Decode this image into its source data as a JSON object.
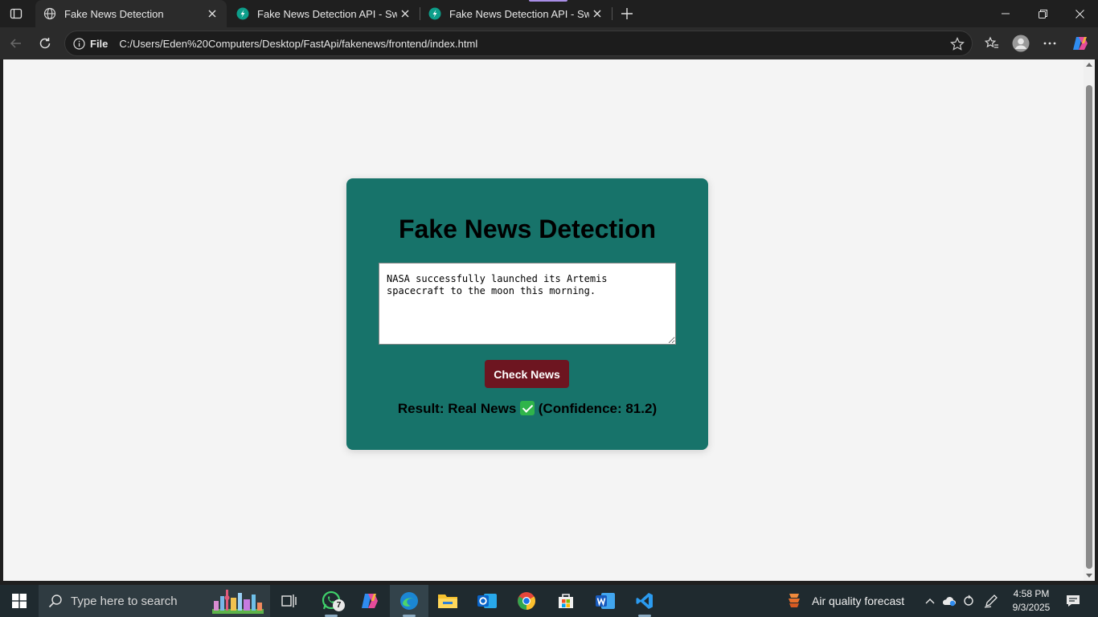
{
  "browser": {
    "tabs": [
      {
        "title": "Fake News Detection",
        "icon": "globe-icon",
        "active": true
      },
      {
        "title": "Fake News Detection API - Swagger UI",
        "icon": "swagger-icon",
        "active": false
      },
      {
        "title": "Fake News Detection API - Swagger UI",
        "icon": "swagger-icon",
        "active": false
      }
    ],
    "address": {
      "scheme_label": "File",
      "url": "C:/Users/Eden%20Computers/Desktop/FastApi/fakenews/frontend/index.html"
    }
  },
  "page": {
    "title": "Fake News Detection",
    "news_text": "NASA successfully launched its Artemis spacecraft to the moon this morning.",
    "button_label": "Check News",
    "result": {
      "prefix": "Result: Real News",
      "suffix": "(Confidence: 81.2)"
    }
  },
  "taskbar": {
    "search_placeholder": "Type here to search",
    "whatsapp_badge": "7",
    "weather_text": "Air quality forecast",
    "time": "4:58 PM",
    "date": "9/3/2025"
  },
  "colors": {
    "card": "#17736a",
    "button": "#6d1520",
    "page_bg": "#f4f4f4"
  }
}
